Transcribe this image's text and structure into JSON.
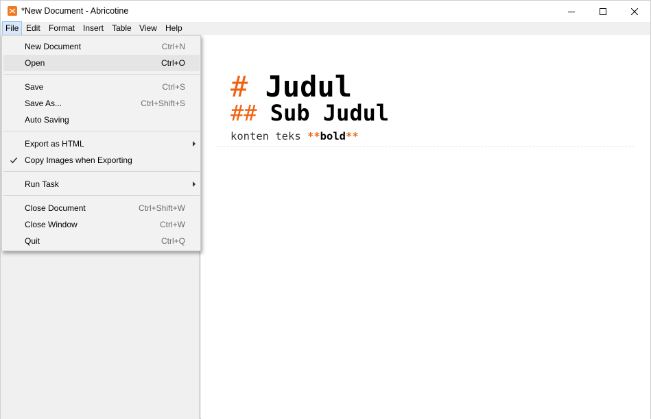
{
  "window": {
    "title": "*New Document - Abricotine",
    "icon": "abricotine-icon",
    "accent_color": "#f07a22"
  },
  "menubar": {
    "items": [
      "File",
      "Edit",
      "Format",
      "Insert",
      "Table",
      "View",
      "Help"
    ],
    "active": "File"
  },
  "file_menu": {
    "new_document": {
      "label": "New Document",
      "shortcut": "Ctrl+N"
    },
    "open": {
      "label": "Open",
      "shortcut": "Ctrl+O"
    },
    "save": {
      "label": "Save",
      "shortcut": "Ctrl+S"
    },
    "save_as": {
      "label": "Save As...",
      "shortcut": "Ctrl+Shift+S"
    },
    "auto_saving": {
      "label": "Auto Saving"
    },
    "export_html": {
      "label": "Export as HTML",
      "submenu": true
    },
    "copy_images": {
      "label": "Copy Images when Exporting",
      "checked": true
    },
    "run_task": {
      "label": "Run Task",
      "submenu": true
    },
    "close_document": {
      "label": "Close Document",
      "shortcut": "Ctrl+Shift+W"
    },
    "close_window": {
      "label": "Close Window",
      "shortcut": "Ctrl+W"
    },
    "quit": {
      "label": "Quit",
      "shortcut": "Ctrl+Q"
    },
    "hovered": "Open"
  },
  "editor": {
    "h1_marker": "#",
    "h1_text": "Judul",
    "h2_marker": "##",
    "h2_text": "Sub Judul",
    "paragraph_text": "konten teks ",
    "bold_marker": "**",
    "bold_text": "bold",
    "marker_color": "#ef6413"
  }
}
